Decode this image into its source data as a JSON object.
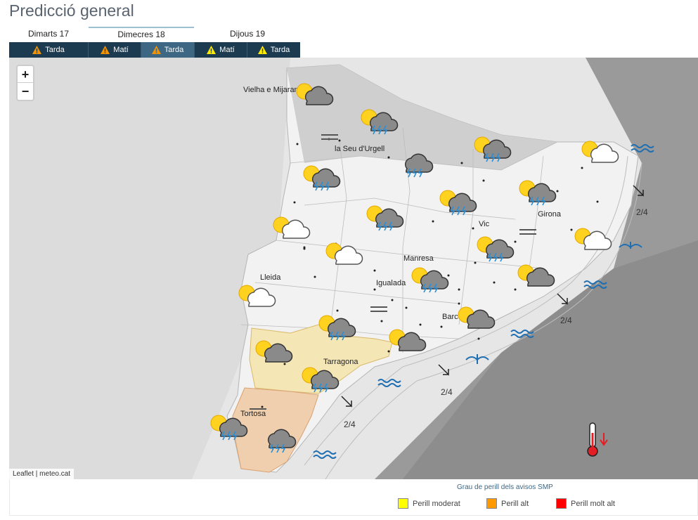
{
  "page_title": "Predicció general",
  "days": [
    {
      "label": "Dimarts 17"
    },
    {
      "label": "Dimecres 18"
    },
    {
      "label": "Dijous 19"
    }
  ],
  "periods": [
    {
      "label": "Tarda",
      "warning_color": "#f39200"
    },
    {
      "label": "Matí",
      "warning_color": "#f39200"
    },
    {
      "label": "Tarda",
      "warning_color": "#f39200"
    },
    {
      "label": "Matí",
      "warning_color": "#ffeb00"
    },
    {
      "label": "Tarda",
      "warning_color": "#ffeb00"
    }
  ],
  "map": {
    "zoom_in": "+",
    "zoom_out": "−",
    "attribution": "Leaflet | meteo.cat",
    "cities": [
      "Vielha e Mijaran",
      "la Seu d'Urgell",
      "Girona",
      "Vic",
      "Manresa",
      "Lleida",
      "Igualada",
      "Barcelona",
      "Tarragona",
      "Tortosa"
    ],
    "wave_labels": [
      "2/4",
      "2/4",
      "2/4",
      "2/4"
    ]
  },
  "legend": {
    "title": "Grau de perill dels avisos SMP",
    "items": [
      {
        "label": "Perill moderat",
        "color": "#ffff00"
      },
      {
        "label": "Perill alt",
        "color": "#ff9900"
      },
      {
        "label": "Perill molt alt",
        "color": "#ff0000"
      }
    ]
  }
}
